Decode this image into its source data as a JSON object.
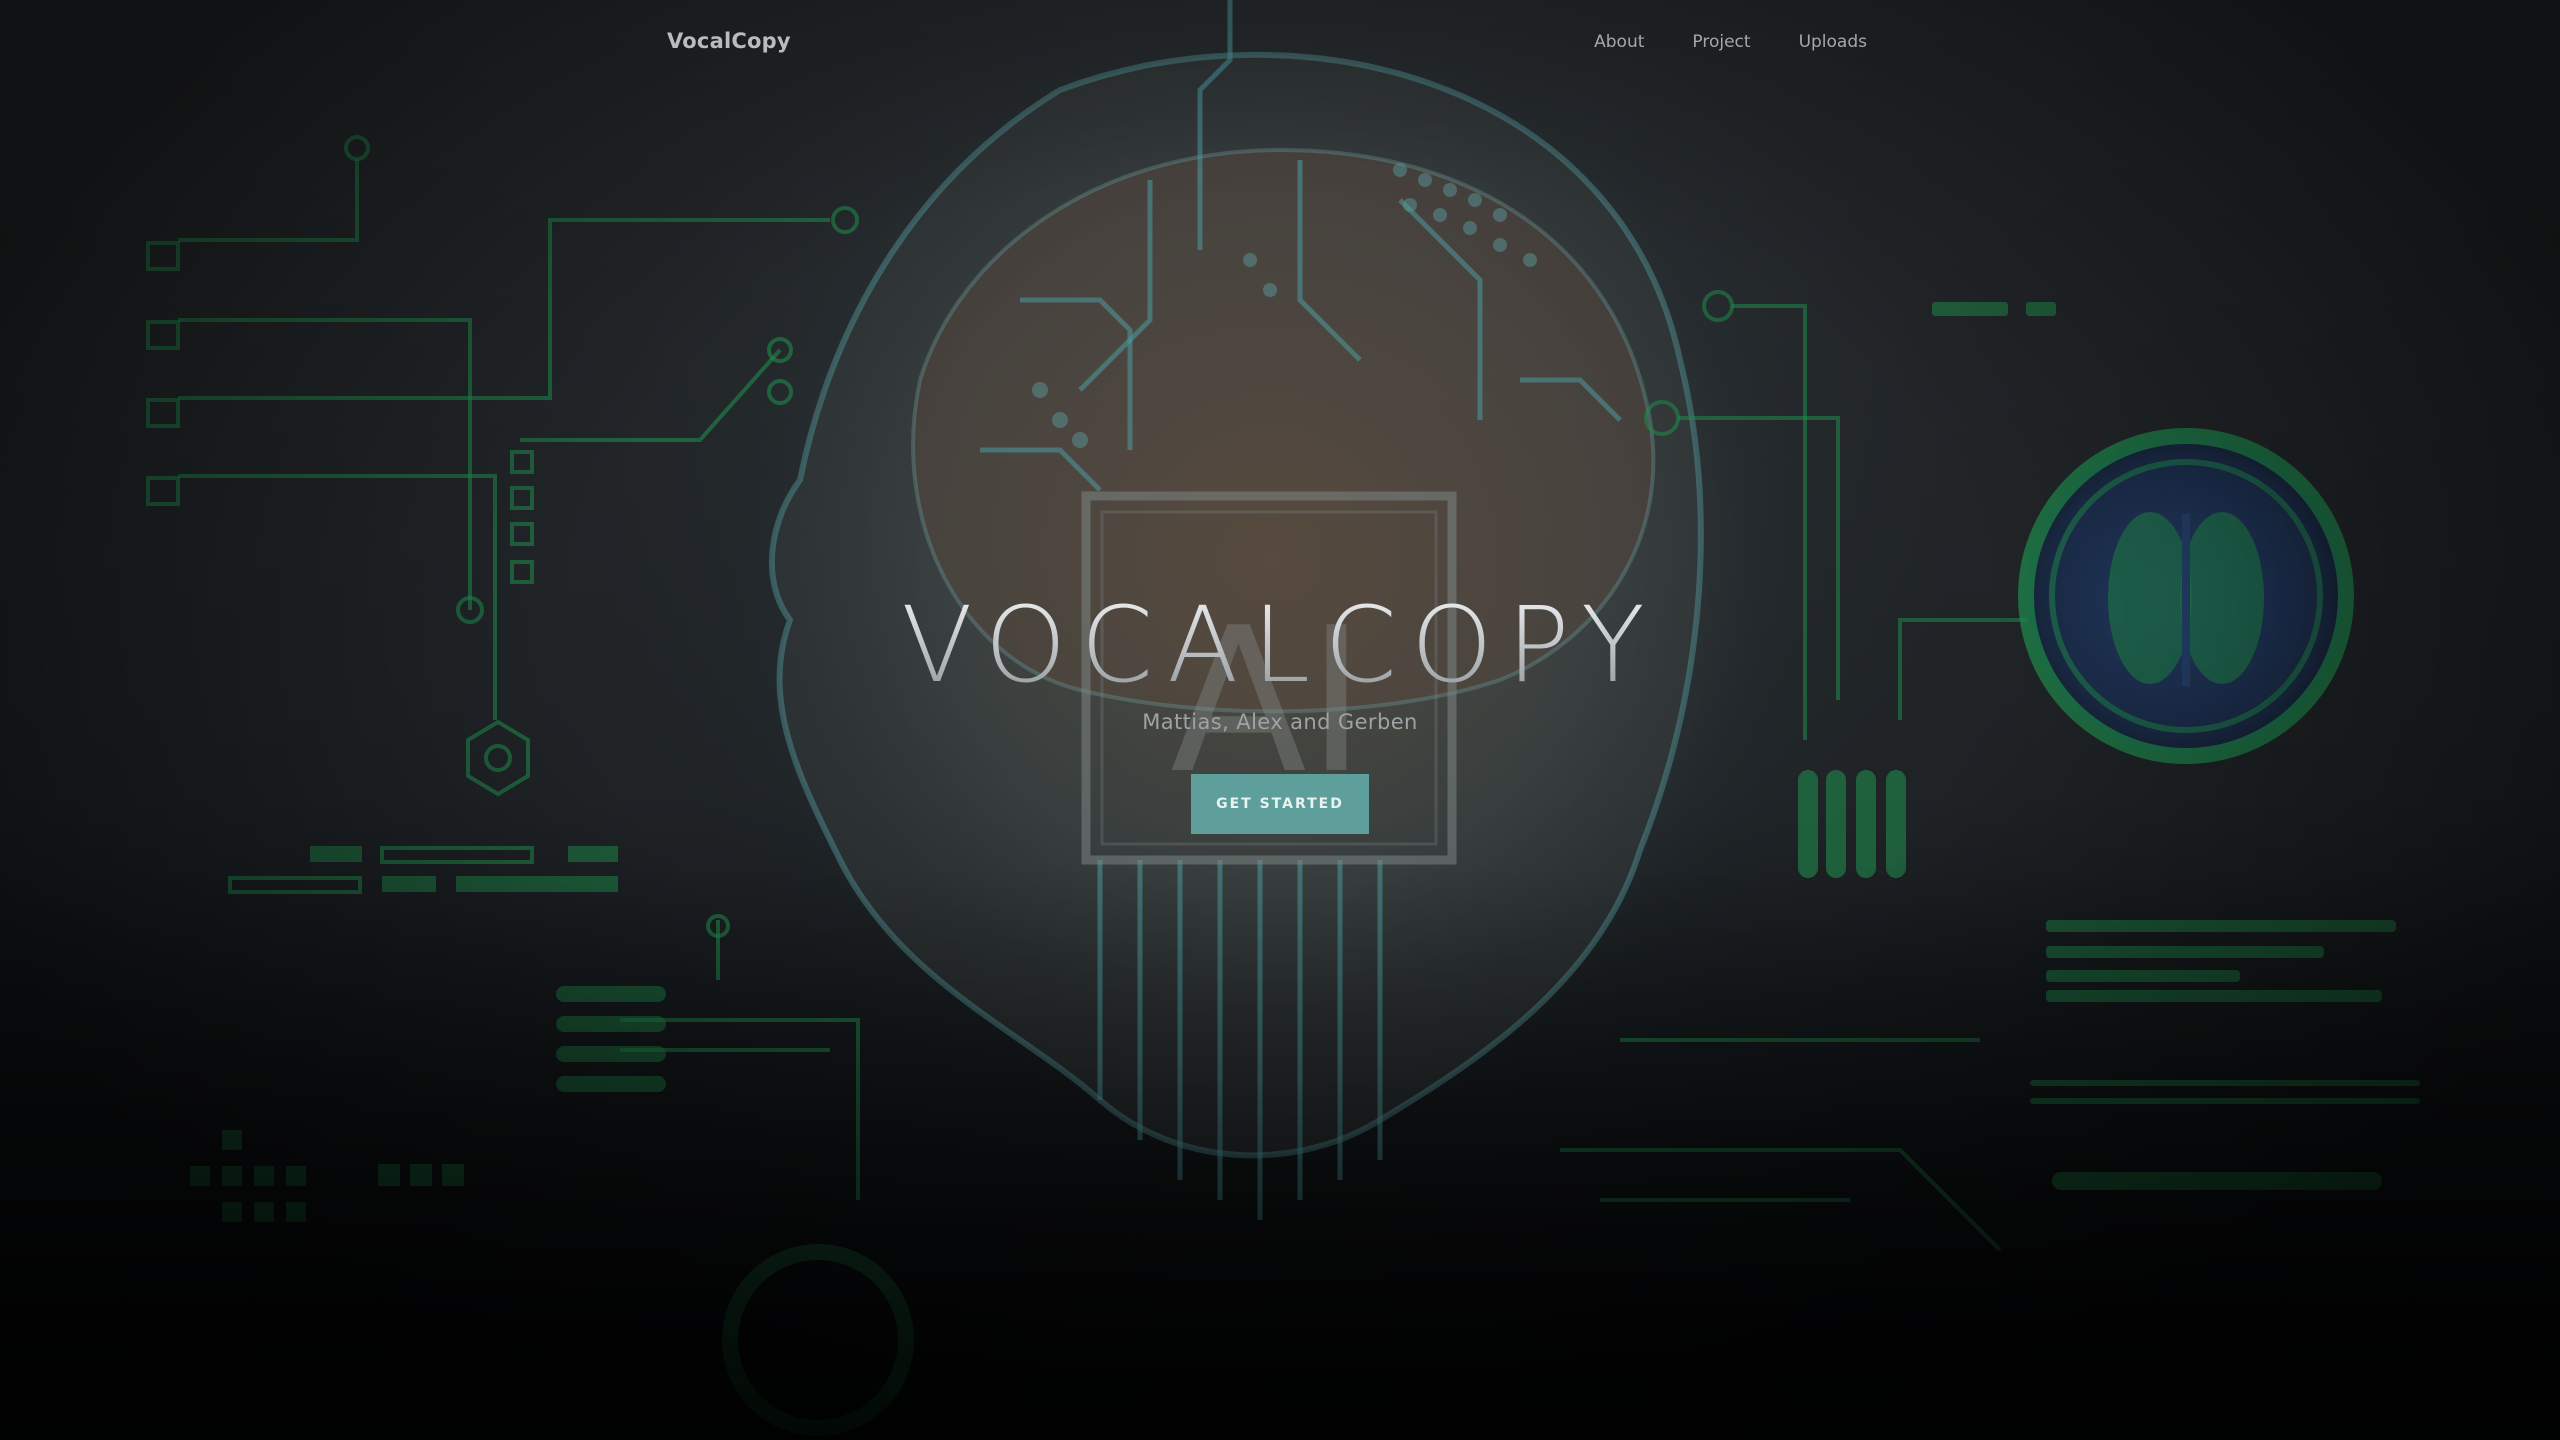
{
  "navbar": {
    "brand": "VocalCopy",
    "links": [
      {
        "label": "About"
      },
      {
        "label": "Project"
      },
      {
        "label": "Uploads"
      }
    ]
  },
  "hero": {
    "title": "VOCALCOPY",
    "subtitle": "Mattias, Alex and Gerben",
    "cta_label": "GET STARTED",
    "background_watermark": "AI"
  },
  "colors": {
    "accent": "#5f9f9b",
    "circuit_green": "#1f8a4c",
    "circuit_teal": "#3f8f94",
    "background_dark": "#1f2326"
  }
}
